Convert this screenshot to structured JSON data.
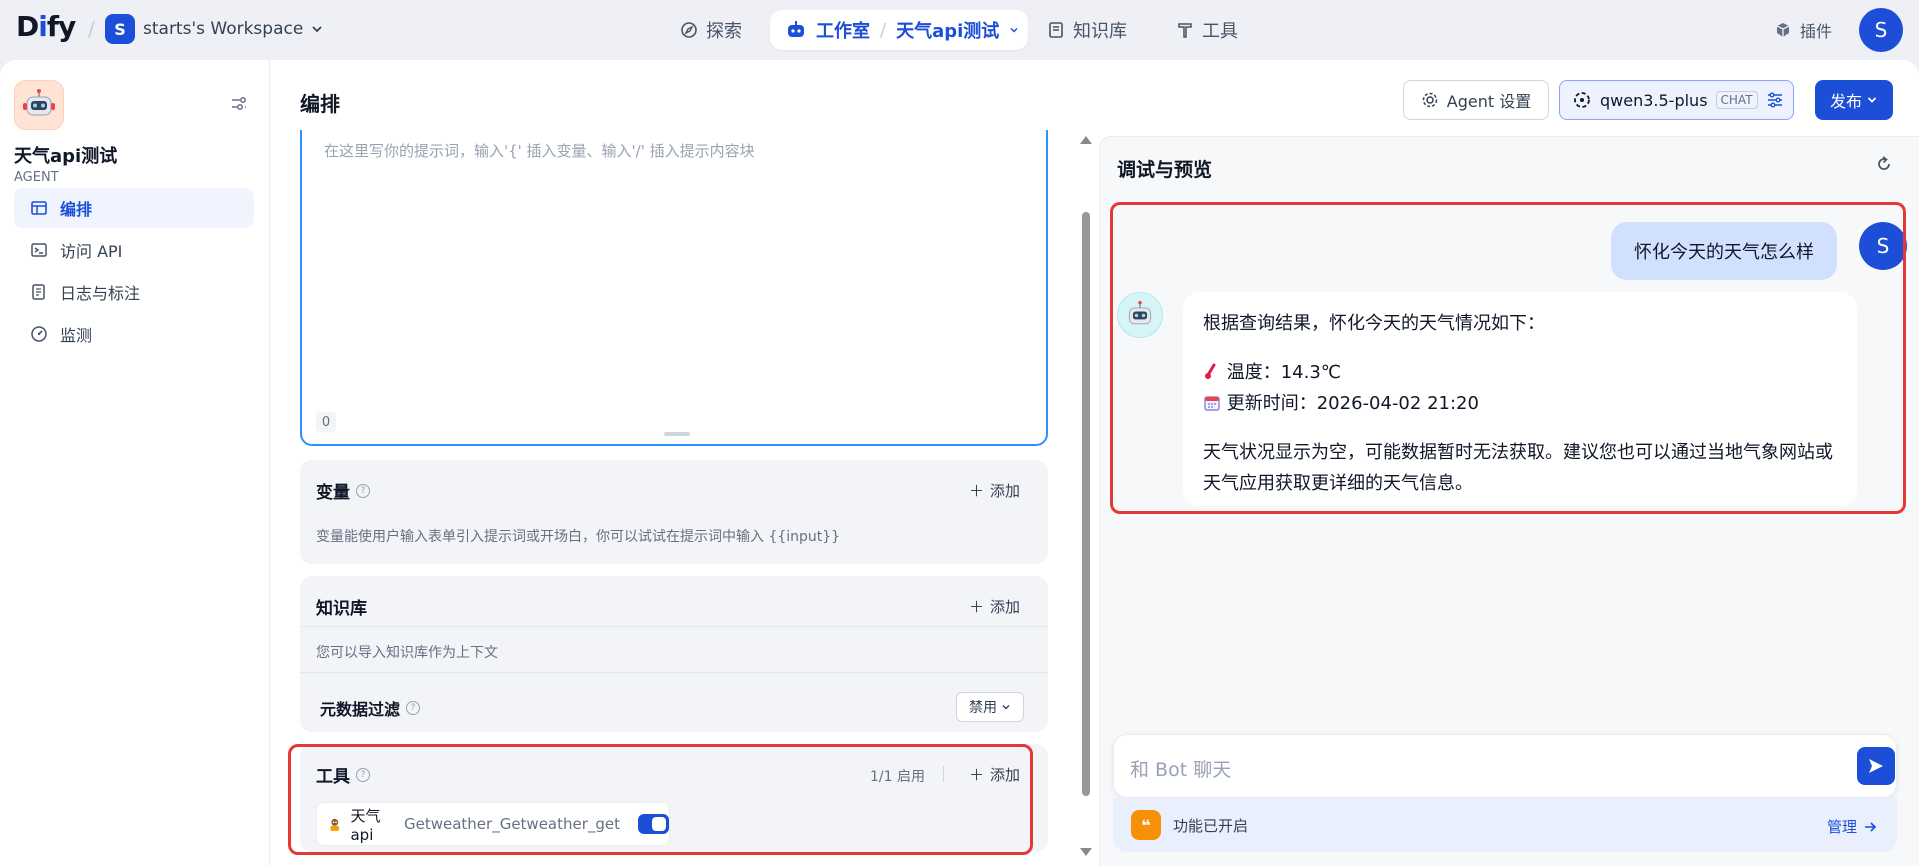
{
  "header": {
    "logo": "Dify",
    "workspace_initial": "S",
    "workspace_name": "starts's Workspace",
    "nav_explore": "探索",
    "nav_studio": "工作室",
    "nav_current_app": "天气api测试",
    "nav_knowledge": "知识库",
    "nav_tools": "工具",
    "plugins": "插件",
    "user_initial": "S"
  },
  "sidebar": {
    "app_name": "天气api测试",
    "app_type": "AGENT",
    "items": [
      {
        "label": "编排",
        "icon": "layout-icon",
        "active": true
      },
      {
        "label": "访问 API",
        "icon": "terminal-icon",
        "active": false
      },
      {
        "label": "日志与标注",
        "icon": "log-icon",
        "active": false
      },
      {
        "label": "监测",
        "icon": "gauge-icon",
        "active": false
      }
    ]
  },
  "main": {
    "title": "编排",
    "agent_settings": "Agent 设置",
    "model_name": "qwen3.5-plus",
    "model_mode": "CHAT",
    "publish": "发布"
  },
  "prompt": {
    "placeholder": "在这里写你的提示词，输入'{' 插入变量、输入'/' 插入提示内容块",
    "char_count": "0"
  },
  "variables": {
    "title": "变量",
    "add": "添加",
    "desc": "变量能使用户输入表单引入提示词或开场白，你可以试试在提示词中输入 {{input}}"
  },
  "knowledge": {
    "title": "知识库",
    "add": "添加",
    "desc": "您可以导入知识库作为上下文",
    "metadata_filter": "元数据过滤",
    "metadata_filter_value": "禁用"
  },
  "tools": {
    "title": "工具",
    "count": "1/1 启用",
    "add": "添加",
    "items": [
      {
        "provider": "天气api",
        "name": "Getweather_Getweather_get",
        "enabled": true
      }
    ]
  },
  "preview": {
    "title": "调试与预览",
    "user_initial": "S",
    "user_message": "怀化今天的天气怎么样",
    "bot_intro": "根据查询结果，怀化今天的天气情况如下：",
    "temp_label": "温度：14.3℃",
    "update_label": "更新时间：2026-04-02 21:20",
    "bot_note": "天气状况显示为空，可能数据暂时无法获取。建议您也可以通过当地气象网站或天气应用获取更详细的天气信息。",
    "input_placeholder": "和 Bot 聊天",
    "features_enabled": "功能已开启",
    "manage": "管理"
  },
  "colors": {
    "accent": "#1d4ed8",
    "highlight_box": "#e53935",
    "prompt_border": "#2e90fa",
    "user_bubble": "#d1e0ff"
  }
}
